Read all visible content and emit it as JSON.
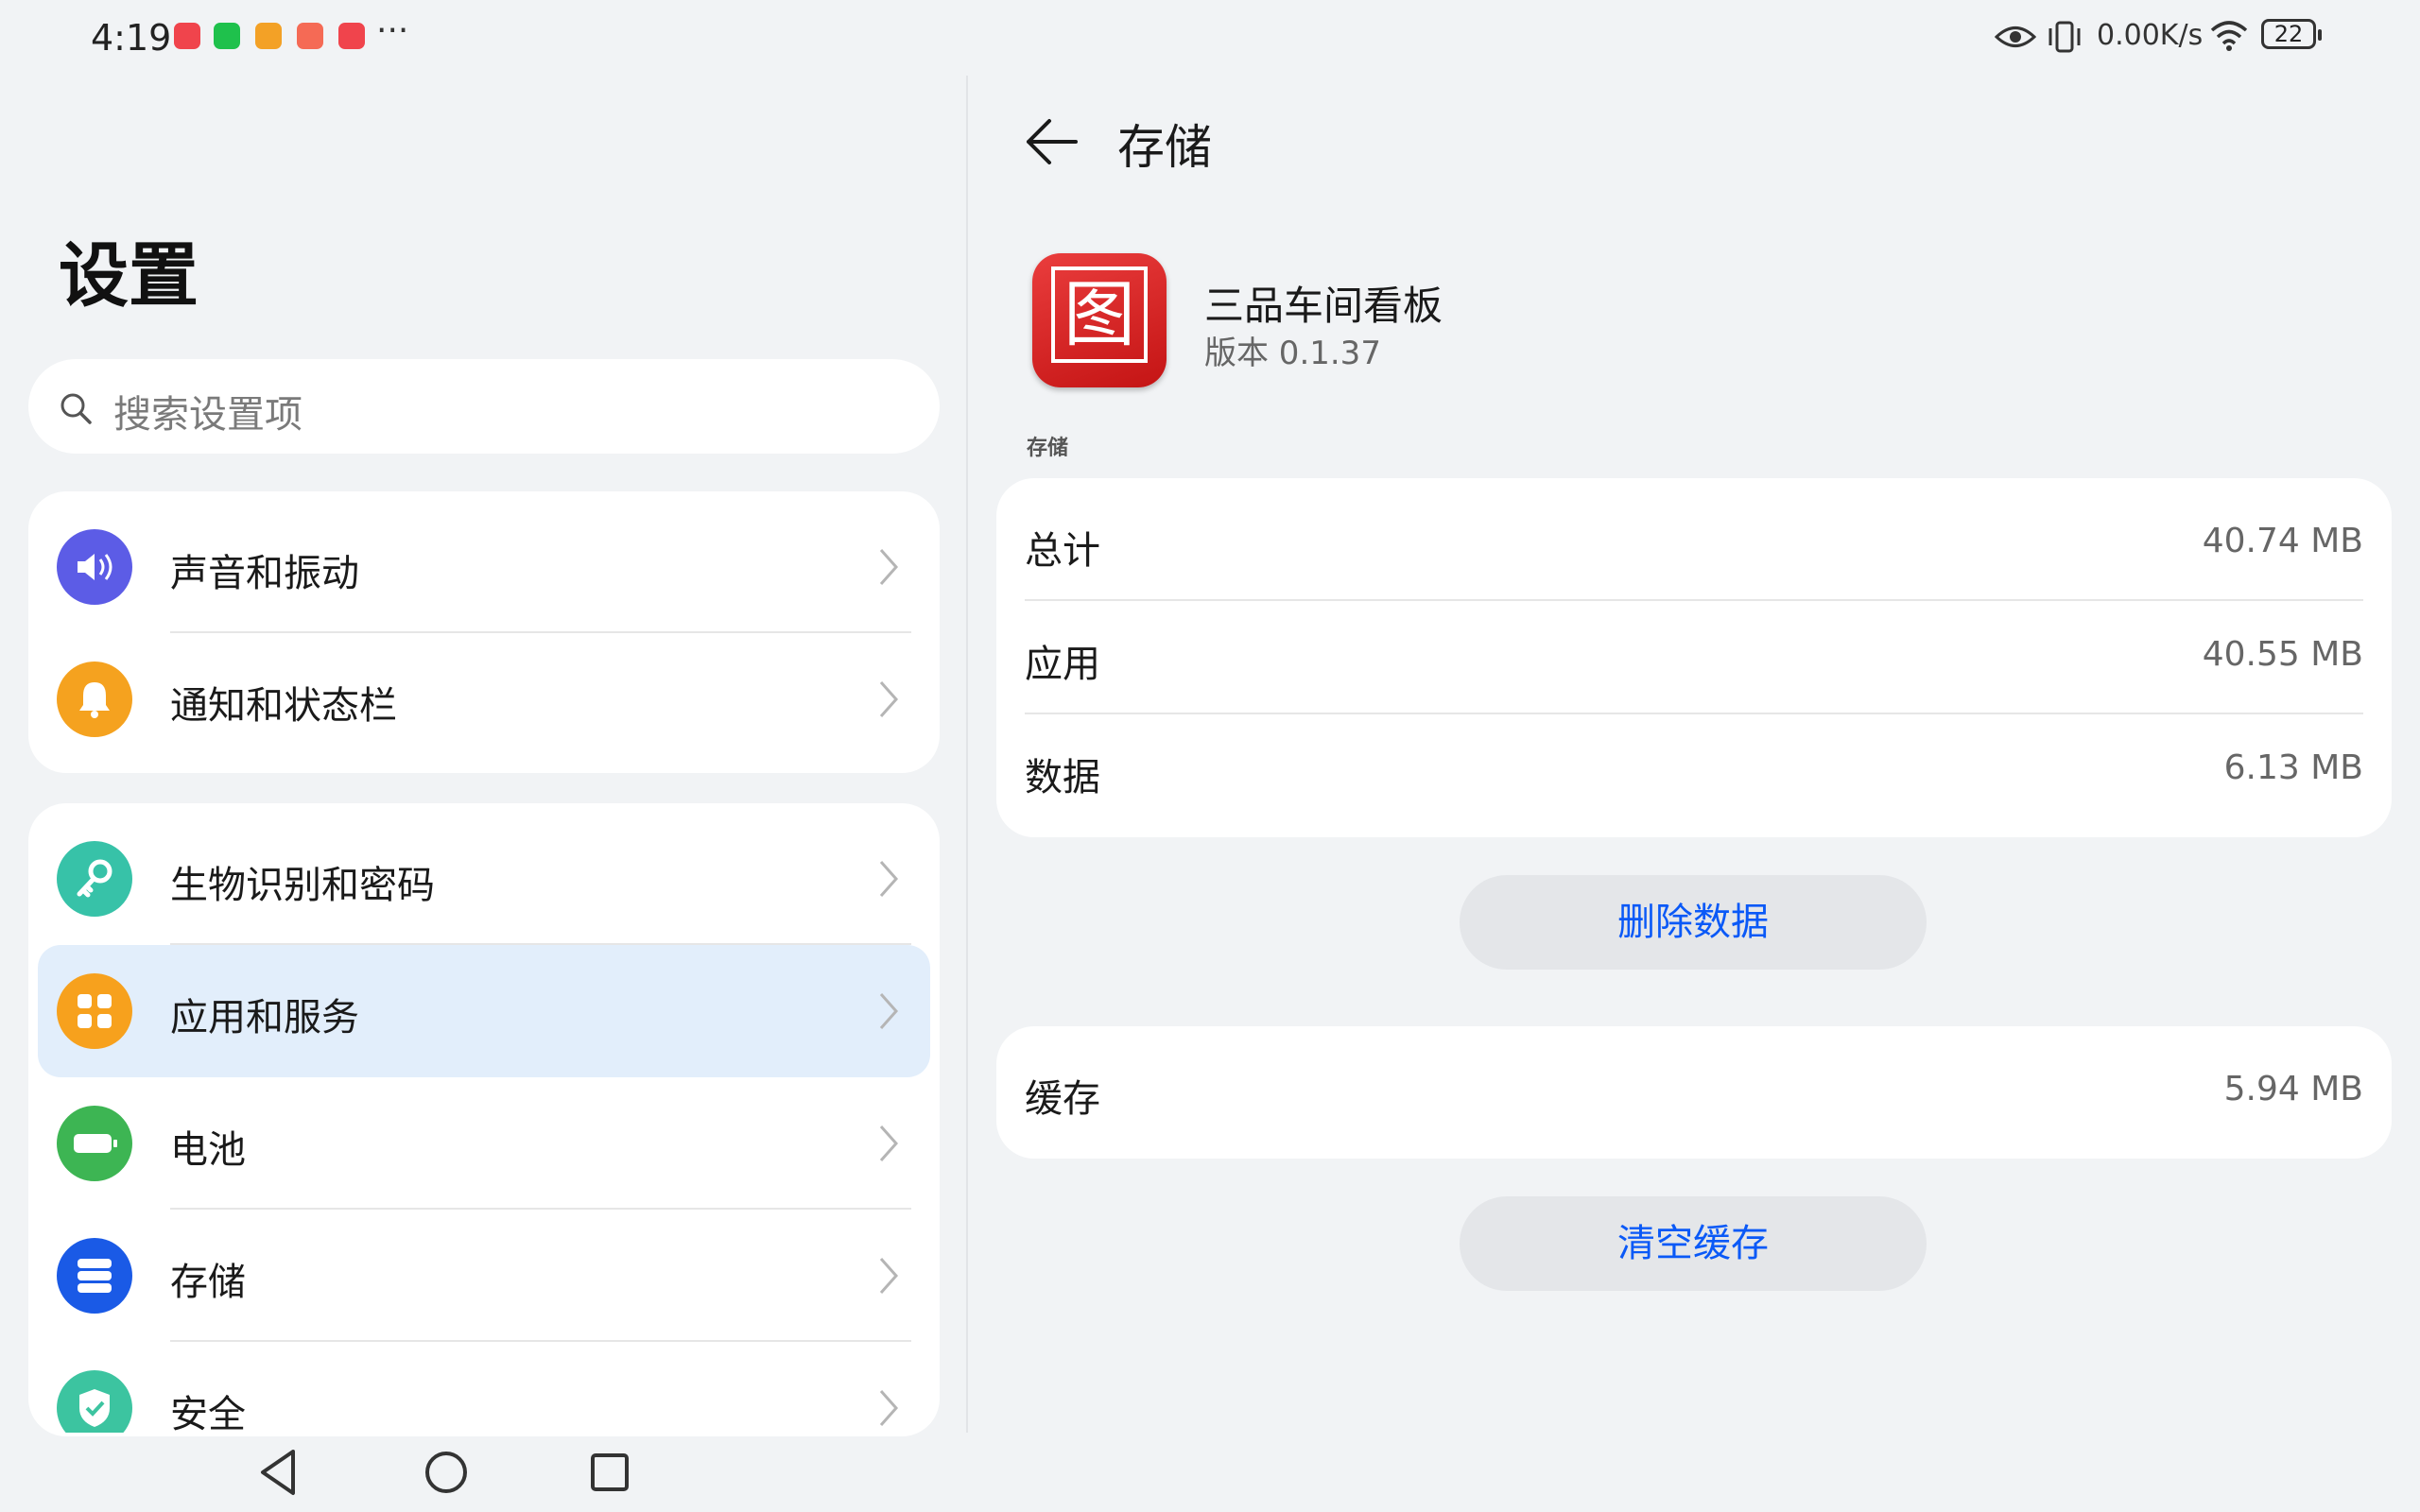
{
  "status_bar": {
    "time": "4:19",
    "more": "···",
    "net_speed": "0.00K/s",
    "battery": "22",
    "notification_colors": [
      "#f0444c",
      "#1fc14c",
      "#f3a126",
      "#f56a55",
      "#f0444c"
    ]
  },
  "left": {
    "title": "设置",
    "search": {
      "placeholder": "搜索设置项"
    },
    "group1": [
      {
        "label": "声音和振动",
        "icon": "speaker-icon",
        "color": "#5c5ce6"
      },
      {
        "label": "通知和状态栏",
        "icon": "bell-icon",
        "color": "#f5a21f"
      }
    ],
    "group2": [
      {
        "label": "生物识别和密码",
        "icon": "key-icon",
        "color": "#37c2a8"
      },
      {
        "label": "应用和服务",
        "icon": "apps-grid-icon",
        "color": "#f7a11d"
      },
      {
        "label": "电池",
        "icon": "battery-icon",
        "color": "#3db553"
      },
      {
        "label": "存储",
        "icon": "storage-icon",
        "color": "#1a5ae6"
      },
      {
        "label": "安全",
        "icon": "shield-icon",
        "color": "#3cc4a0"
      }
    ]
  },
  "right": {
    "title": "存储",
    "app": {
      "name": "三品车间看板",
      "version": "版本 0.1.37",
      "icon_glyph": "图"
    },
    "section_label": "存储",
    "storage_rows": [
      {
        "label": "总计",
        "value": "40.74 MB"
      },
      {
        "label": "应用",
        "value": "40.55 MB"
      },
      {
        "label": "数据",
        "value": "6.13 MB"
      }
    ],
    "delete_data_label": "删除数据",
    "cache": {
      "label": "缓存",
      "value": "5.94 MB"
    },
    "clear_cache_label": "清空缓存"
  },
  "colors": {
    "accent": "#0a59f7",
    "highlight": "#e2eefb"
  }
}
